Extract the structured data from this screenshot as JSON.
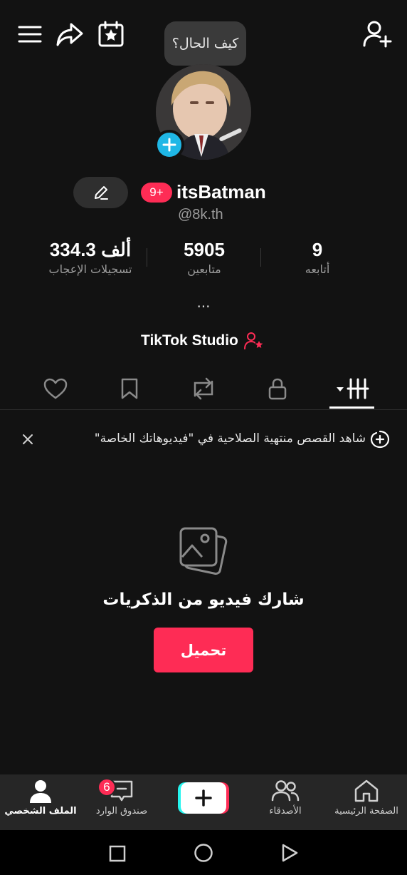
{
  "header": {
    "status_bubble": "كيف الحال؟"
  },
  "profile": {
    "username": "itsBatman",
    "handle": "@8k.th",
    "notification_badge": "9+",
    "bio_more": "...",
    "studio_label": "TikTok Studio"
  },
  "stats": {
    "likes": {
      "value": "334.3 ألف",
      "label": "تسجيلات الإعجاب"
    },
    "followers": {
      "value": "5905",
      "label": "متابعين"
    },
    "following": {
      "value": "9",
      "label": "أتابعه"
    }
  },
  "notice": {
    "text": "شاهد القصص منتهية الصلاحية في \"فيديوهاتك الخاصة\""
  },
  "empty_state": {
    "title": "شارك فيديو من الذكريات",
    "upload_label": "تحميل"
  },
  "bottom_nav": {
    "profile": "الملف الشخصي",
    "inbox": "صندوق الوارد",
    "inbox_badge": "6",
    "friends": "الأصدقاء",
    "home": "الصفحة الرئيسية"
  },
  "colors": {
    "accent": "#fe2c55",
    "cyan": "#25f4ee",
    "avatar_add": "#1fb7e6",
    "background": "#121212"
  }
}
